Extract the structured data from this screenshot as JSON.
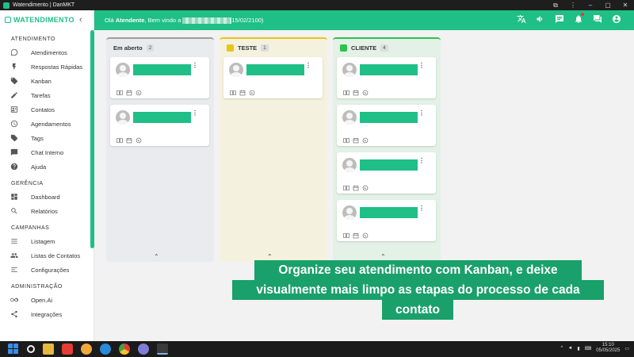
{
  "window": {
    "title": "Watendimento | DanMKT",
    "controls": [
      "⧉",
      "⋮",
      "–",
      "▢",
      "✕"
    ]
  },
  "sidebar": {
    "logo": "WATENDIMENTO",
    "sections": [
      {
        "title": "ATENDIMENTO",
        "items": [
          {
            "label": "Atendimentos",
            "icon": "whatsapp-icon"
          },
          {
            "label": "Respostas Rápidas",
            "icon": "bolt-icon"
          },
          {
            "label": "Kanban",
            "icon": "tag-icon"
          },
          {
            "label": "Tarefas",
            "icon": "pencil-icon"
          },
          {
            "label": "Contatos",
            "icon": "contact-card-icon"
          },
          {
            "label": "Agendamentos",
            "icon": "clock-icon"
          },
          {
            "label": "Tags",
            "icon": "tags-icon"
          },
          {
            "label": "Chat Interno",
            "icon": "chat-icon"
          },
          {
            "label": "Ajuda",
            "icon": "help-icon"
          }
        ]
      },
      {
        "title": "GERÊNCIA",
        "items": [
          {
            "label": "Dashboard",
            "icon": "dashboard-icon"
          },
          {
            "label": "Relatórios",
            "icon": "search-icon"
          }
        ]
      },
      {
        "title": "CAMPANHAS",
        "items": [
          {
            "label": "Listagem",
            "icon": "list-icon"
          },
          {
            "label": "Listas de Contatos",
            "icon": "people-icon"
          },
          {
            "label": "Configurações",
            "icon": "settings-list-icon"
          }
        ]
      },
      {
        "title": "ADMINISTRAÇÃO",
        "items": [
          {
            "label": "Open.Ai",
            "icon": "infinity-icon"
          },
          {
            "label": "Integrações",
            "icon": "share-icon"
          }
        ]
      }
    ]
  },
  "header": {
    "greeting_prefix": "Olá",
    "user": "Atendente",
    "greeting_middle": ", Bem vindo a",
    "date_suffix": "15/02/2100)"
  },
  "board": {
    "columns": [
      {
        "name": "Em aberto",
        "count": "2",
        "color": "#9e9e9e",
        "bg": "#e9ebee",
        "cards": 2
      },
      {
        "name": "TESTE",
        "count": "1",
        "color": "#e8c517",
        "bg": "#f4f1df",
        "cards": 1
      },
      {
        "name": "CLIENTE",
        "count": "4",
        "color": "#2bc34a",
        "bg": "#e3f1e6",
        "cards": 4
      }
    ],
    "collapse_glyph": "⌃",
    "menu_glyph": "⋮"
  },
  "banner": {
    "line1": "Organize seu atendimento com Kanban, e deixe",
    "line2": "visualmente mais limpo as etapas do processo de cada",
    "line3": "contato"
  },
  "taskbar": {
    "time": "15:10",
    "date": "05/05/2025"
  },
  "colors": {
    "brand": "#1fbf87",
    "banner": "#1aa06b"
  }
}
